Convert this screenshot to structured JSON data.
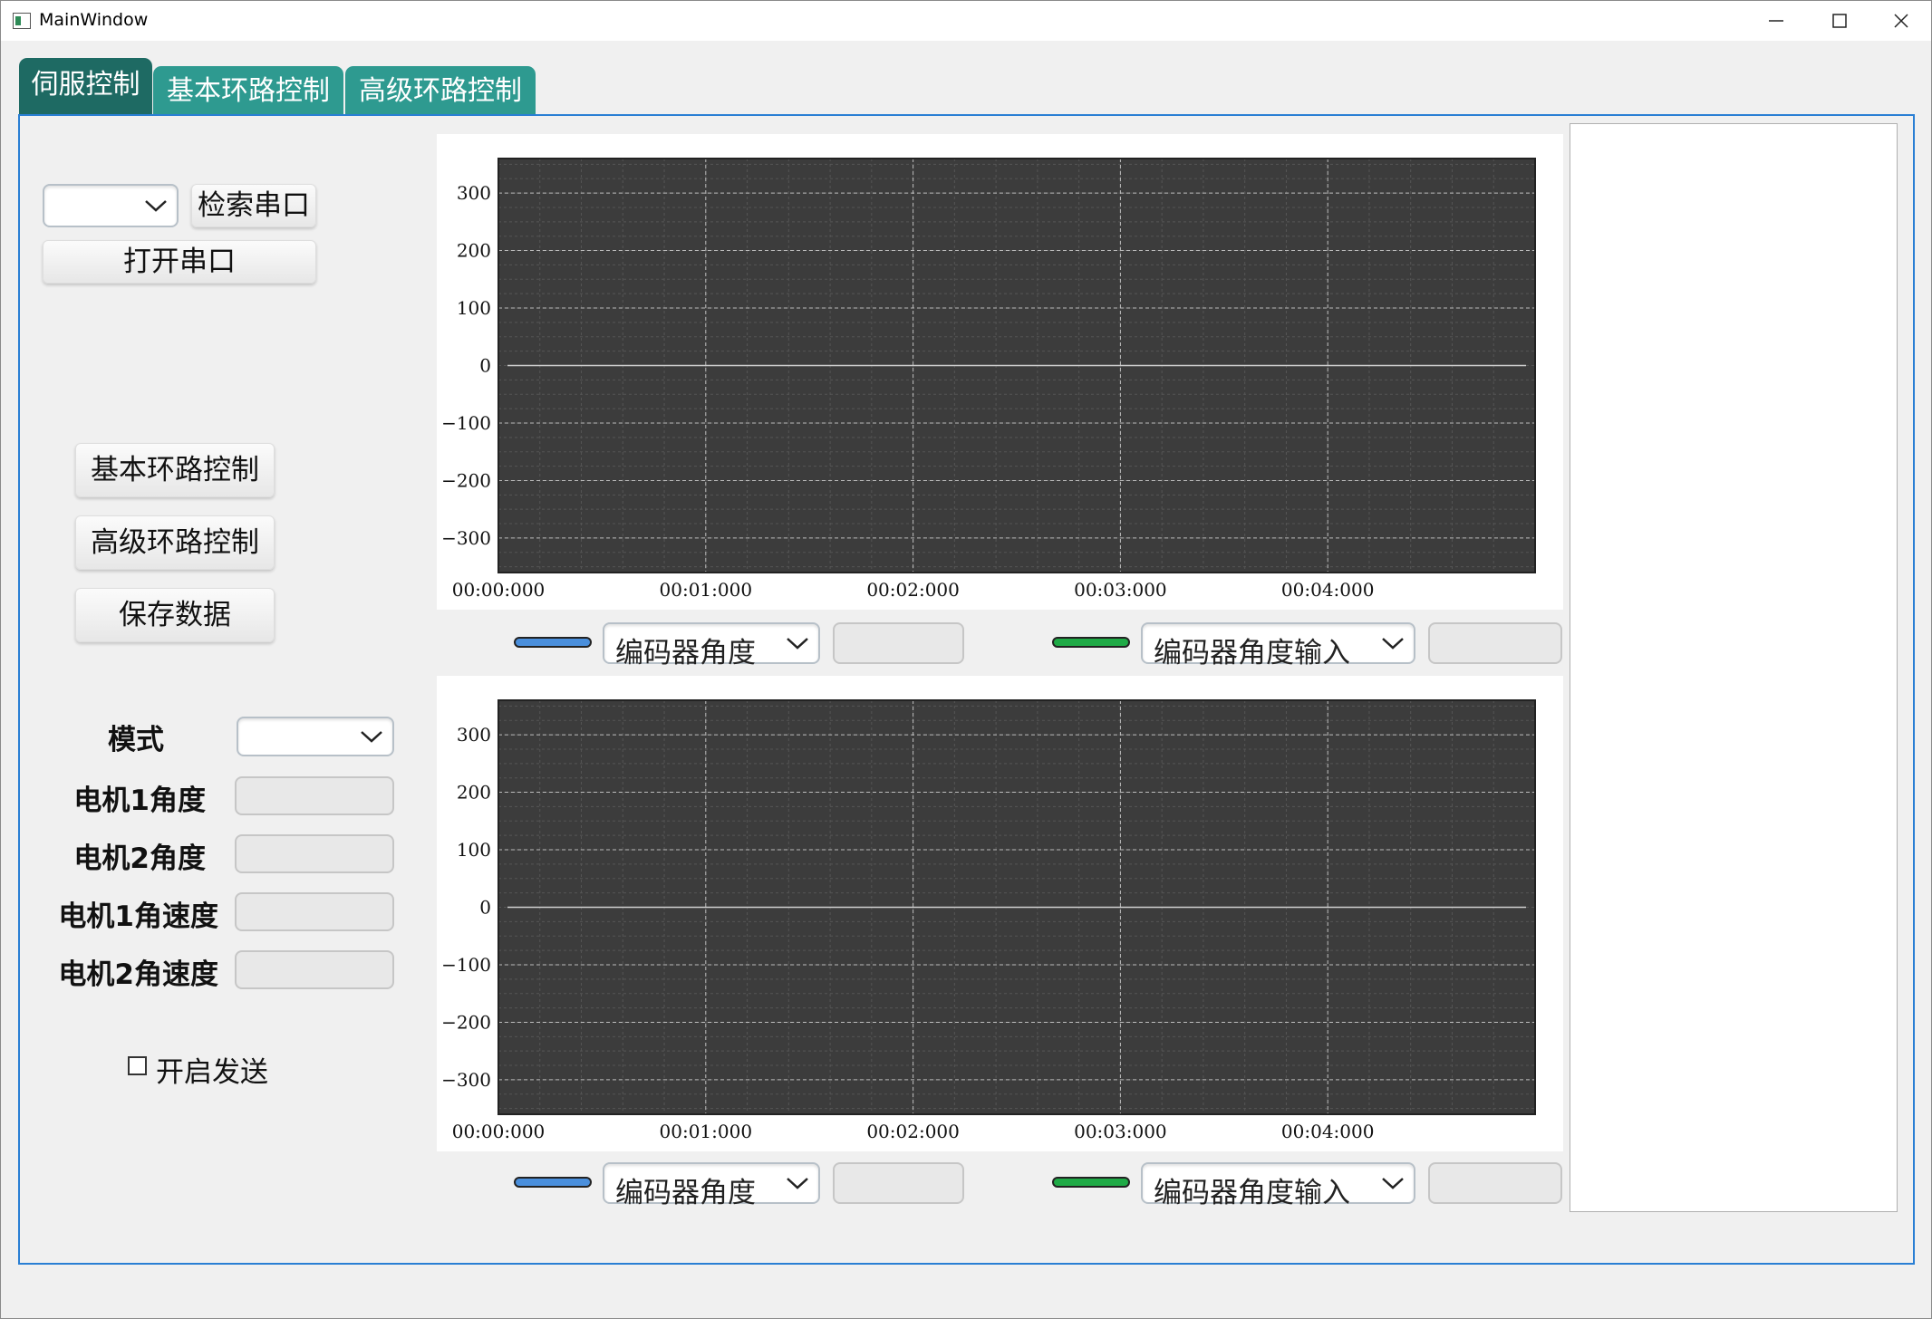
{
  "window": {
    "title": "MainWindow"
  },
  "tabs": [
    {
      "label": "伺服控制",
      "active": true
    },
    {
      "label": "基本环路控制",
      "active": false
    },
    {
      "label": "高级环路控制",
      "active": false
    }
  ],
  "serial": {
    "port_value": "",
    "search_label": "检索串口",
    "open_label": "打开串口"
  },
  "nav_buttons": {
    "basic": "基本环路控制",
    "advanced": "高级环路控制",
    "save": "保存数据"
  },
  "form": {
    "mode_label": "模式",
    "mode_value": "",
    "motor1_angle_label": "电机1角度",
    "motor2_angle_label": "电机2角度",
    "motor1_speed_label": "电机1角速度",
    "motor2_speed_label": "电机2角速度",
    "send_enable_label": "开启发送",
    "send_enable_checked": false
  },
  "colors": {
    "series1": "#4a8fdc",
    "series2": "#1faa46",
    "plot_bg": "#3c3c3c",
    "accent": "#2a7fd4"
  },
  "chart_data": [
    {
      "type": "line",
      "title": "",
      "xlabel": "",
      "ylabel": "",
      "xticks": [
        "00:00:000",
        "00:01:000",
        "00:02:000",
        "00:03:000",
        "00:04:000"
      ],
      "yticks": [
        300,
        200,
        100,
        0,
        -100,
        -200,
        -300
      ],
      "ylim": [
        -360,
        360
      ],
      "grid": true,
      "series": [
        {
          "legend_select": "编码器角度",
          "color": "#4a8fdc",
          "value": "",
          "values": [
            0,
            0,
            0,
            0,
            0
          ]
        },
        {
          "legend_select": "编码器角度输入",
          "color": "#1faa46",
          "value": "",
          "values": [
            0,
            0,
            0,
            0,
            0
          ]
        }
      ]
    },
    {
      "type": "line",
      "title": "",
      "xlabel": "",
      "ylabel": "",
      "xticks": [
        "00:00:000",
        "00:01:000",
        "00:02:000",
        "00:03:000",
        "00:04:000"
      ],
      "yticks": [
        300,
        200,
        100,
        0,
        -100,
        -200,
        -300
      ],
      "ylim": [
        -360,
        360
      ],
      "grid": true,
      "series": [
        {
          "legend_select": "编码器角度",
          "color": "#4a8fdc",
          "value": "",
          "values": [
            0,
            0,
            0,
            0,
            0
          ]
        },
        {
          "legend_select": "编码器角度输入",
          "color": "#1faa46",
          "value": "",
          "values": [
            0,
            0,
            0,
            0,
            0
          ]
        }
      ]
    }
  ]
}
